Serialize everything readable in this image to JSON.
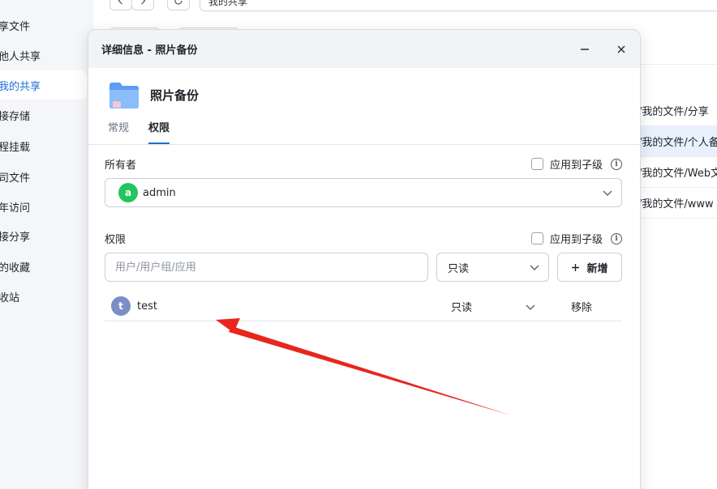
{
  "sidebar": {
    "items": [
      {
        "label": "享文件"
      },
      {
        "label": "他人共享"
      },
      {
        "label": "我的共享"
      },
      {
        "label": "接存储"
      },
      {
        "label": "程挂载"
      },
      {
        "label": "司文件"
      },
      {
        "label": "年访问"
      },
      {
        "label": "接分享"
      },
      {
        "label": "的收藏"
      },
      {
        "label": "收站"
      }
    ]
  },
  "toolbar": {
    "path": "我的共享"
  },
  "file_rows": [
    {
      "path": "/我的文件/分享"
    },
    {
      "path": "/我的文件/个人备"
    },
    {
      "path": "/我的文件/Web文"
    },
    {
      "path": "/我的文件/www"
    }
  ],
  "dialog": {
    "title": "详细信息 - 照片备份",
    "folder_name": "照片备份",
    "tabs": [
      {
        "label": "常规"
      },
      {
        "label": "权限"
      }
    ],
    "owner": {
      "label": "所有者",
      "apply_label": "应用到子级",
      "avatar_letter": "a",
      "avatar_color": "#22c55e",
      "name": "admin"
    },
    "permissions": {
      "label": "权限",
      "apply_label": "应用到子级",
      "input_placeholder": "用户/用户组/应用",
      "level_selected": "只读",
      "add_label": "新增",
      "rows": [
        {
          "avatar_letter": "t",
          "avatar_color": "#7b8ec7",
          "user": "test",
          "level": "只读",
          "remove_label": "移除"
        }
      ]
    }
  },
  "colors": {
    "accent": "#1e6fd9",
    "annotation_arrow": "#e8261c"
  }
}
